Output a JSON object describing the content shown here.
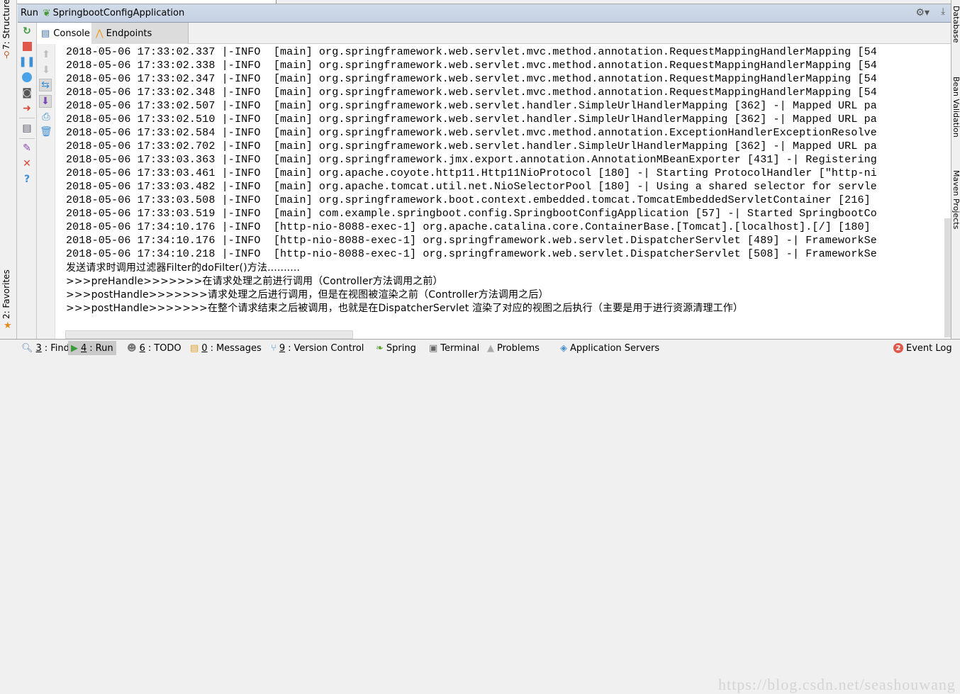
{
  "window": {
    "run_label": "Run",
    "config_name": "SpringbootConfigApplication"
  },
  "left_sidebar": {
    "structure_tab": "7: Structure",
    "favorites_tab": "2: Favorites"
  },
  "right_sidebar": {
    "tabs": [
      "Database",
      "Bean Validation",
      "Maven Projects"
    ]
  },
  "tabs": [
    {
      "label": "Console",
      "icon": "console-icon",
      "active": true
    },
    {
      "label": "Endpoints",
      "icon": "endpoints-icon",
      "active": false
    }
  ],
  "run_toolbar": [
    "rerun-icon",
    "stop-icon",
    "pause-icon",
    "debug-globe-icon",
    "camera-icon",
    "exit-icon",
    "layout-icon",
    "pin-icon",
    "close-icon",
    "help-icon"
  ],
  "console_toolbar": [
    "up-arrow-icon",
    "down-arrow-icon",
    "soft-wrap-icon",
    "scroll-to-end-icon",
    "print-icon",
    "trash-icon"
  ],
  "console": {
    "lines": [
      "2018-05-06 17:33:02.337 |-INFO  [main] org.springframework.web.servlet.mvc.method.annotation.RequestMappingHandlerMapping [54",
      "2018-05-06 17:33:02.338 |-INFO  [main] org.springframework.web.servlet.mvc.method.annotation.RequestMappingHandlerMapping [54",
      "2018-05-06 17:33:02.347 |-INFO  [main] org.springframework.web.servlet.mvc.method.annotation.RequestMappingHandlerMapping [54",
      "2018-05-06 17:33:02.348 |-INFO  [main] org.springframework.web.servlet.mvc.method.annotation.RequestMappingHandlerMapping [54",
      "2018-05-06 17:33:02.507 |-INFO  [main] org.springframework.web.servlet.handler.SimpleUrlHandlerMapping [362] -| Mapped URL pa",
      "2018-05-06 17:33:02.510 |-INFO  [main] org.springframework.web.servlet.handler.SimpleUrlHandlerMapping [362] -| Mapped URL pa",
      "2018-05-06 17:33:02.584 |-INFO  [main] org.springframework.web.servlet.mvc.method.annotation.ExceptionHandlerExceptionResolve",
      "2018-05-06 17:33:02.702 |-INFO  [main] org.springframework.web.servlet.handler.SimpleUrlHandlerMapping [362] -| Mapped URL pa",
      "2018-05-06 17:33:03.363 |-INFO  [main] org.springframework.jmx.export.annotation.AnnotationMBeanExporter [431] -| Registering",
      "2018-05-06 17:33:03.461 |-INFO  [main] org.apache.coyote.http11.Http11NioProtocol [180] -| Starting ProtocolHandler [\"http-ni",
      "2018-05-06 17:33:03.482 |-INFO  [main] org.apache.tomcat.util.net.NioSelectorPool [180] -| Using a shared selector for servle",
      "2018-05-06 17:33:03.508 |-INFO  [main] org.springframework.boot.context.embedded.tomcat.TomcatEmbeddedServletContainer [216] ",
      "2018-05-06 17:33:03.519 |-INFO  [main] com.example.springboot.config.SpringbootConfigApplication [57] -| Started SpringbootCo",
      "2018-05-06 17:34:10.176 |-INFO  [http-nio-8088-exec-1] org.apache.catalina.core.ContainerBase.[Tomcat].[localhost].[/] [180] ",
      "2018-05-06 17:34:10.176 |-INFO  [http-nio-8088-exec-1] org.springframework.web.servlet.DispatcherServlet [489] -| FrameworkSe",
      "2018-05-06 17:34:10.218 |-INFO  [http-nio-8088-exec-1] org.springframework.web.servlet.DispatcherServlet [508] -| FrameworkSe"
    ],
    "custom_lines": [
      "发送请求时调用过滤器Filter的doFilter()方法..........",
      ">>>preHandle>>>>>>>在请求处理之前进行调用（Controller方法调用之前）",
      ">>>postHandle>>>>>>>请求处理之后进行调用，但是在视图被渲染之前（Controller方法调用之后）",
      ">>>postHandle>>>>>>>在整个请求结束之后被调用，也就是在DispatcherServlet 渲染了对应的视图之后执行（主要是用于进行资源清理工作）"
    ]
  },
  "bottom_bar": {
    "items": [
      {
        "key": "3",
        "label": "Find",
        "icon": "search-icon"
      },
      {
        "key": "4",
        "label": "Run",
        "icon": "run-icon",
        "selected": true
      },
      {
        "key": "6",
        "label": "TODO",
        "icon": "todo-icon"
      },
      {
        "key": "0",
        "label": "Messages",
        "icon": "messages-icon"
      },
      {
        "key": "9",
        "label": "Version Control",
        "icon": "version-control-icon"
      },
      {
        "key": "",
        "label": "Spring",
        "icon": "spring-leaf-icon"
      },
      {
        "key": "",
        "label": "Terminal",
        "icon": "terminal-icon"
      },
      {
        "key": "",
        "label": "Problems",
        "icon": "warning-icon"
      },
      {
        "key": "",
        "label": "Application Servers",
        "icon": "app-servers-icon"
      }
    ],
    "event_log": {
      "label": "Event Log",
      "count": "2"
    }
  },
  "watermark": "https://blog.csdn.net/seashouwang",
  "colors": {
    "header_bg": "#ccd7e8",
    "accent_green": "#5aa02c",
    "stop_red": "#e0574b",
    "info_blue": "#3d8fd6"
  }
}
